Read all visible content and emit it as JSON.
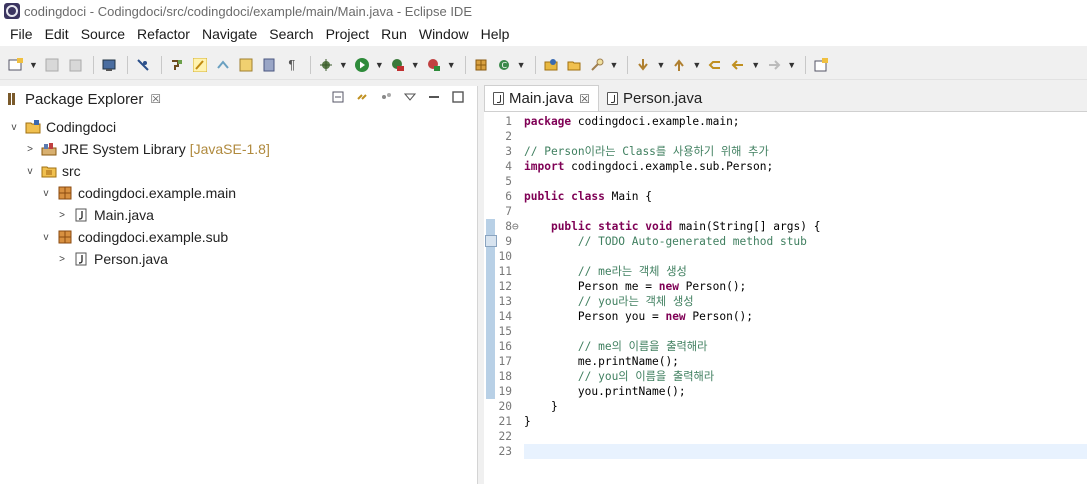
{
  "window": {
    "title": "codingdoci - Codingdoci/src/codingdoci/example/main/Main.java - Eclipse IDE"
  },
  "menu": [
    "File",
    "Edit",
    "Source",
    "Refactor",
    "Navigate",
    "Search",
    "Project",
    "Run",
    "Window",
    "Help"
  ],
  "package_explorer": {
    "title": "Package Explorer",
    "close_glyph": "☒",
    "tree": [
      {
        "label": "Codingdoci",
        "decoration": "",
        "icon": "java-project-icon",
        "expanded": "v"
      },
      {
        "label": "JRE System Library",
        "decoration": "[JavaSE-1.8]",
        "icon": "library-icon",
        "expanded": ">"
      },
      {
        "label": "src",
        "decoration": "",
        "icon": "source-folder-icon",
        "expanded": "v"
      },
      {
        "label": "codingdoci.example.main",
        "decoration": "",
        "icon": "package-icon",
        "expanded": "v"
      },
      {
        "label": "Main.java",
        "decoration": "",
        "icon": "java-file-icon",
        "expanded": ">"
      },
      {
        "label": "codingdoci.example.sub",
        "decoration": "",
        "icon": "package-icon",
        "expanded": "v"
      },
      {
        "label": "Person.java",
        "decoration": "",
        "icon": "java-file-icon",
        "expanded": ">"
      }
    ]
  },
  "editor": {
    "tabs": [
      {
        "label": "Main.java",
        "active": true,
        "close_glyph": "☒"
      },
      {
        "label": "Person.java",
        "active": false,
        "close_glyph": ""
      }
    ],
    "lines": [
      {
        "n": "1",
        "indent": "",
        "parts": [
          {
            "t": "package",
            "c": "kw"
          },
          {
            "t": " codingdoci.example.main;",
            "c": ""
          }
        ]
      },
      {
        "n": "2",
        "indent": "",
        "parts": []
      },
      {
        "n": "3",
        "indent": "",
        "parts": [
          {
            "t": "// Person이라는 Class를 사용하기 위해 추가",
            "c": "cm"
          }
        ]
      },
      {
        "n": "4",
        "indent": "",
        "parts": [
          {
            "t": "import",
            "c": "kw"
          },
          {
            "t": " codingdoci.example.sub.Person;",
            "c": ""
          }
        ]
      },
      {
        "n": "5",
        "indent": "",
        "parts": []
      },
      {
        "n": "6",
        "indent": "",
        "parts": [
          {
            "t": "public",
            "c": "kw"
          },
          {
            "t": " ",
            "c": ""
          },
          {
            "t": "class",
            "c": "kw"
          },
          {
            "t": " Main {",
            "c": ""
          }
        ]
      },
      {
        "n": "7",
        "indent": "",
        "parts": []
      },
      {
        "n": "8",
        "indent": "    ",
        "parts": [
          {
            "t": "public",
            "c": "kw"
          },
          {
            "t": " ",
            "c": ""
          },
          {
            "t": "static",
            "c": "kw"
          },
          {
            "t": " ",
            "c": ""
          },
          {
            "t": "void",
            "c": "kw"
          },
          {
            "t": " main(String[] args) {",
            "c": ""
          }
        ]
      },
      {
        "n": "9",
        "indent": "        ",
        "parts": [
          {
            "t": "// TODO Auto-generated method stub",
            "c": "cm"
          }
        ]
      },
      {
        "n": "10",
        "indent": "",
        "parts": []
      },
      {
        "n": "11",
        "indent": "        ",
        "parts": [
          {
            "t": "// me라는 객체 생성",
            "c": "cm"
          }
        ]
      },
      {
        "n": "12",
        "indent": "        ",
        "parts": [
          {
            "t": "Person me = ",
            "c": ""
          },
          {
            "t": "new",
            "c": "kw"
          },
          {
            "t": " Person();",
            "c": ""
          }
        ]
      },
      {
        "n": "13",
        "indent": "        ",
        "parts": [
          {
            "t": "// you라는 객체 생성",
            "c": "cm"
          }
        ]
      },
      {
        "n": "14",
        "indent": "        ",
        "parts": [
          {
            "t": "Person you = ",
            "c": ""
          },
          {
            "t": "new",
            "c": "kw"
          },
          {
            "t": " Person();",
            "c": ""
          }
        ]
      },
      {
        "n": "15",
        "indent": "",
        "parts": []
      },
      {
        "n": "16",
        "indent": "        ",
        "parts": [
          {
            "t": "// me의 이름을 출력해라",
            "c": "cm"
          }
        ]
      },
      {
        "n": "17",
        "indent": "        ",
        "parts": [
          {
            "t": "me.printName();",
            "c": ""
          }
        ]
      },
      {
        "n": "18",
        "indent": "        ",
        "parts": [
          {
            "t": "// you의 이름을 출력해라",
            "c": "cm"
          }
        ]
      },
      {
        "n": "19",
        "indent": "        ",
        "parts": [
          {
            "t": "you.printName();",
            "c": ""
          }
        ]
      },
      {
        "n": "20",
        "indent": "    ",
        "parts": [
          {
            "t": "}",
            "c": ""
          }
        ]
      },
      {
        "n": "21",
        "indent": "",
        "parts": [
          {
            "t": "}",
            "c": ""
          }
        ]
      },
      {
        "n": "22",
        "indent": "",
        "parts": []
      },
      {
        "n": "23",
        "indent": "",
        "parts": []
      }
    ],
    "fold_marker": "⊖"
  },
  "colors": {
    "keyword": "#7f0055",
    "comment": "#3f7f5f",
    "current_line": "#e8f2fe",
    "gutter_mark": "#b8d0e6"
  }
}
